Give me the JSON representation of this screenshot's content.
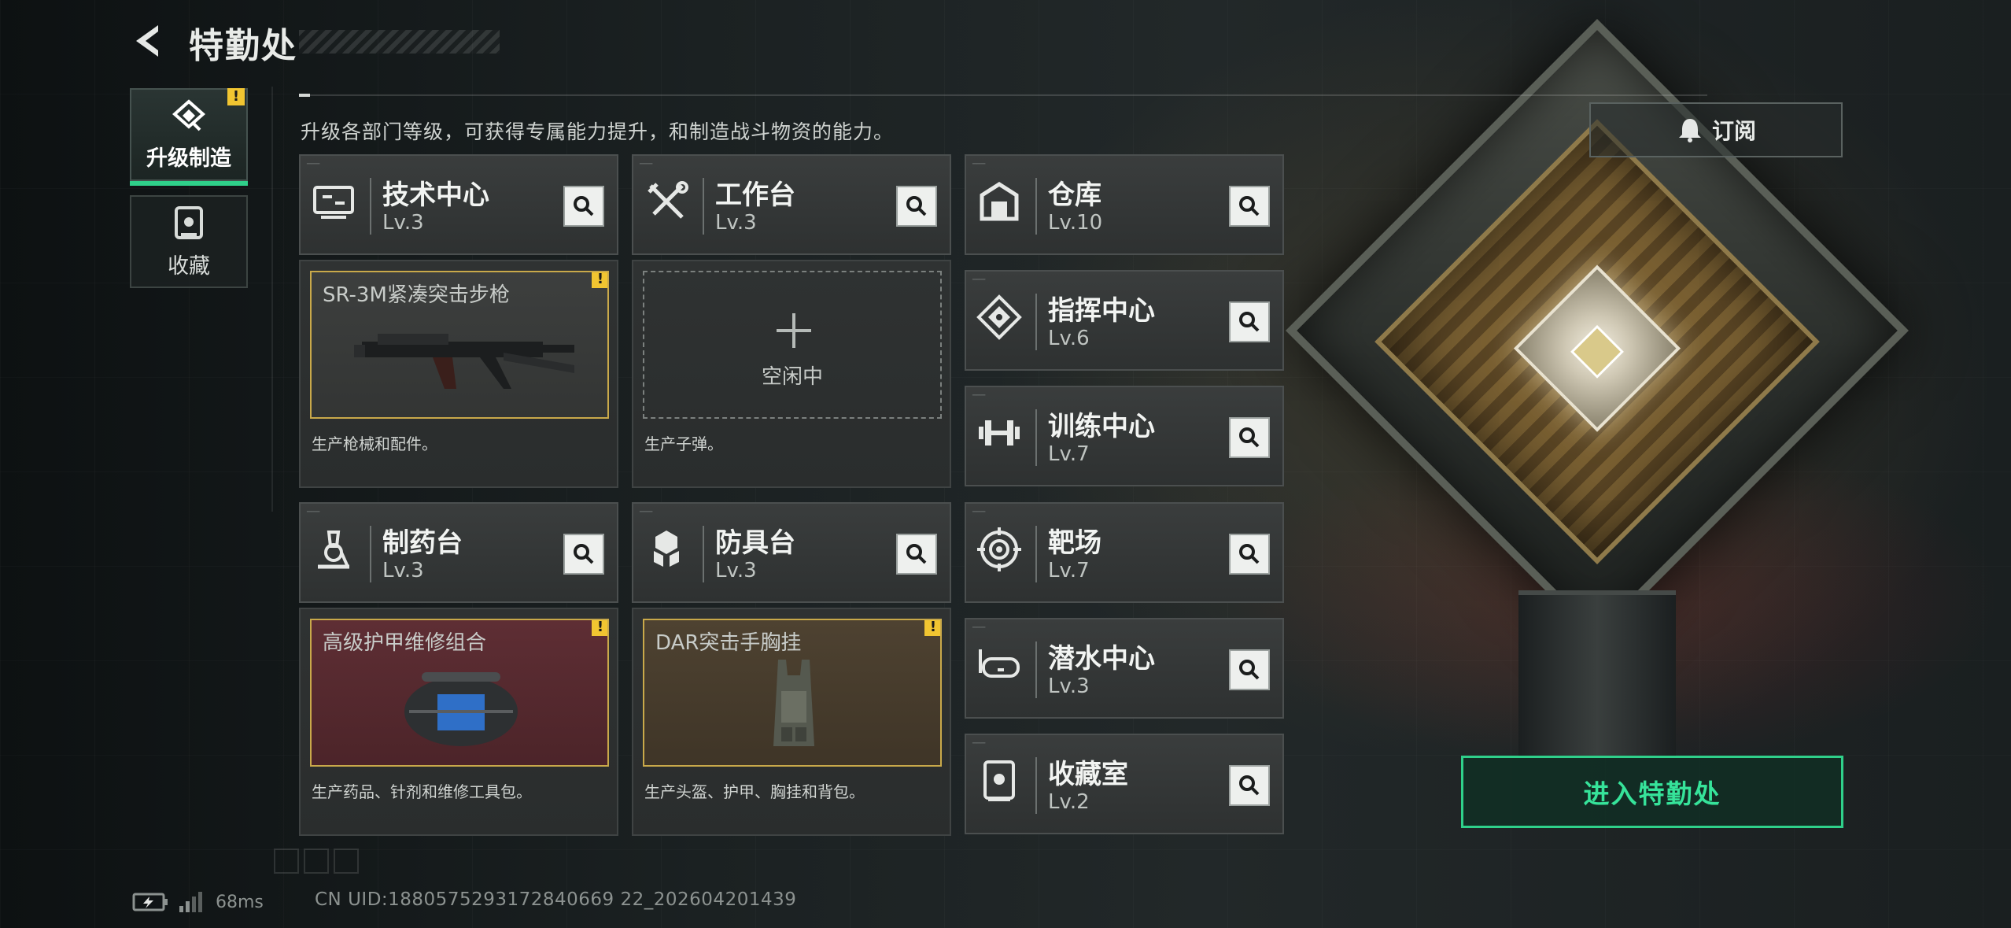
{
  "header": {
    "title": "特勤处"
  },
  "nav": {
    "items": [
      {
        "label": "升级制造",
        "active": true,
        "warning": "!"
      },
      {
        "label": "收藏",
        "active": false
      }
    ]
  },
  "subtitle": "升级各部门等级，可获得专属能力提升，和制造战斗物资的能力。",
  "stations": [
    {
      "name": "技术中心",
      "level": "Lv.3",
      "icon": "tech-center-icon"
    },
    {
      "name": "工作台",
      "level": "Lv.3",
      "icon": "workbench-icon"
    },
    {
      "name": "仓库",
      "level": "Lv.10",
      "icon": "warehouse-icon"
    },
    {
      "name": "指挥中心",
      "level": "Lv.6",
      "icon": "command-center-icon"
    },
    {
      "name": "训练中心",
      "level": "Lv.7",
      "icon": "training-center-icon"
    },
    {
      "name": "制药台",
      "level": "Lv.3",
      "icon": "pharmacy-icon"
    },
    {
      "name": "防具台",
      "level": "Lv.3",
      "icon": "armor-bench-icon"
    },
    {
      "name": "靶场",
      "level": "Lv.7",
      "icon": "shooting-range-icon"
    },
    {
      "name": "潜水中心",
      "level": "Lv.3",
      "icon": "diving-center-icon"
    },
    {
      "name": "收藏室",
      "level": "Lv.2",
      "icon": "collection-room-icon"
    }
  ],
  "production": [
    {
      "item": "SR-3M紧凑突击步枪",
      "desc": "生产枪械和配件。",
      "warning": "!"
    },
    {
      "item": "",
      "empty_label": "空闲中",
      "desc": "生产子弹。"
    },
    {
      "item": "高级护甲维修组合",
      "desc": "生产药品、针剂和维修工具包。",
      "warning": "!"
    },
    {
      "item": "DAR突击手胸挂",
      "desc": "生产头盔、护甲、胸挂和背包。",
      "warning": "!"
    }
  ],
  "subscribe_label": "订阅",
  "enter_button": "进入特勤处",
  "status": {
    "ping": "68ms",
    "uid": "CN UID:1880575293172840669 22_202604201439"
  },
  "colors": {
    "accent": "#2fd08a",
    "warning": "#f1c531",
    "slot_border": "#c9a94a"
  }
}
